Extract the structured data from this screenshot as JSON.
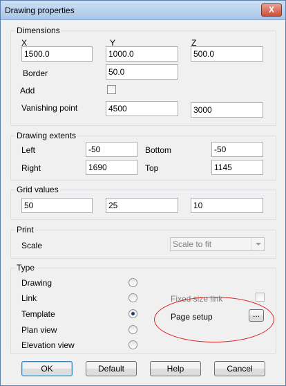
{
  "window": {
    "title": "Drawing properties",
    "close_glyph": "X"
  },
  "dimensions": {
    "title": "Dimensions",
    "x_label": "X",
    "y_label": "Y",
    "z_label": "Z",
    "x_value": "1500.0",
    "y_value": "1000.0",
    "z_value": "500.0",
    "border_label": "Border",
    "border_value": "50.0",
    "add_label": "Add",
    "add_checked": false,
    "vanishing_label": "Vanishing point",
    "vanishing_1": "4500",
    "vanishing_2": "3000"
  },
  "extents": {
    "title": "Drawing extents",
    "left_label": "Left",
    "left_value": "-50",
    "bottom_label": "Bottom",
    "bottom_value": "-50",
    "right_label": "Right",
    "right_value": "1690",
    "top_label": "Top",
    "top_value": "1145"
  },
  "grid": {
    "title": "Grid values",
    "v1": "50",
    "v2": "25",
    "v3": "10"
  },
  "print": {
    "title": "Print",
    "scale_label": "Scale",
    "scale_value": "Scale to fit"
  },
  "type": {
    "title": "Type",
    "options": [
      "Drawing",
      "Link",
      "Template",
      "Plan view",
      "Elevation view"
    ],
    "selected": "Template",
    "fixed_size_link_label": "Fixed size link",
    "page_setup_label": "Page setup",
    "page_setup_button": "..."
  },
  "buttons": {
    "ok": "OK",
    "default": "Default",
    "help": "Help",
    "cancel": "Cancel"
  },
  "colors": {
    "annotation": "#d92020",
    "title_bar": "#b9d1ea"
  }
}
